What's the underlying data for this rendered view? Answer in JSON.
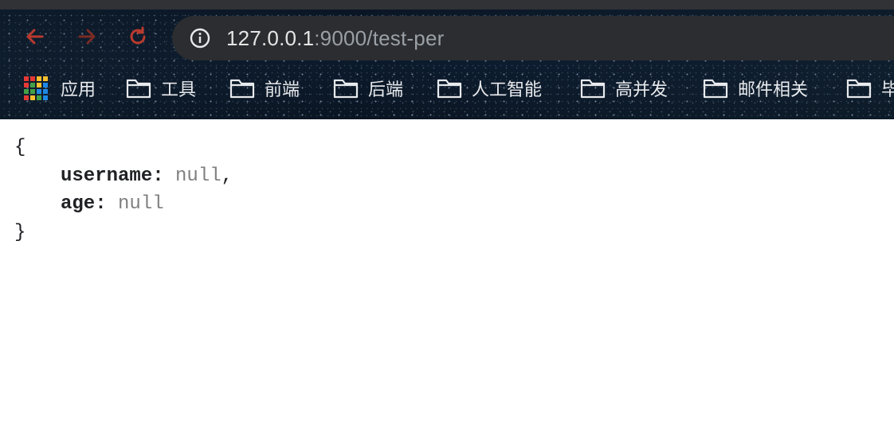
{
  "browser": {
    "url": {
      "host": "127.0.0.1",
      "rest": ":9000/test-per"
    },
    "bookmarks": [
      {
        "label": "应用",
        "icon": "apps-grid-icon"
      },
      {
        "label": "工具",
        "icon": "folder-icon"
      },
      {
        "label": "前端",
        "icon": "folder-icon"
      },
      {
        "label": "后端",
        "icon": "folder-icon"
      },
      {
        "label": "人工智能",
        "icon": "folder-icon"
      },
      {
        "label": "高并发",
        "icon": "folder-icon"
      },
      {
        "label": "邮件相关",
        "icon": "folder-icon"
      },
      {
        "label": "毕",
        "icon": "folder-icon"
      }
    ],
    "nav_color": "#c0392b"
  },
  "json_view": {
    "open_brace": "{",
    "fields": [
      {
        "key": "username",
        "value": "null",
        "trail": ","
      },
      {
        "key": "age",
        "value": "null",
        "trail": ""
      }
    ],
    "close_brace": "}"
  }
}
